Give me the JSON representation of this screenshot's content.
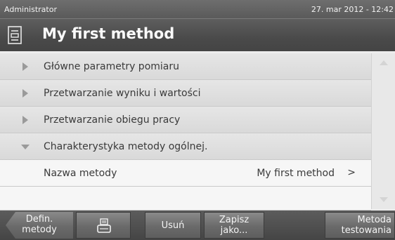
{
  "status": {
    "user": "Administrator",
    "datetime": "27. mar 2012 - 12:42"
  },
  "header": {
    "title": "My first method",
    "icon": "method-document-icon"
  },
  "list": {
    "sections": [
      {
        "label": "Główne parametry pomiaru",
        "expanded": false
      },
      {
        "label": "Przetwarzanie wyniku i wartości",
        "expanded": false
      },
      {
        "label": "Przetwarzanie obiegu pracy",
        "expanded": false
      },
      {
        "label": "Charakterystyka metody ogólnej.",
        "expanded": true
      }
    ],
    "settings": [
      {
        "label": "Nazwa metody",
        "value": "My first method",
        "chevron": ">"
      }
    ]
  },
  "toolbar": {
    "define_line1": "Defin.",
    "define_line2": "metody",
    "print_icon": "printer-icon",
    "delete": "Usuń",
    "save_line1": "Zapisz",
    "save_line2": "jako...",
    "test_line1": "Metoda",
    "test_line2": "testowania"
  }
}
